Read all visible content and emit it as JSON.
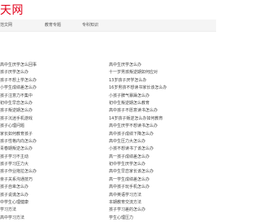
{
  "site": {
    "logo_text": "天网",
    "accent_color": "#e2001a"
  },
  "nav": {
    "items": [
      {
        "label": "范文网"
      },
      {
        "label": "教育专题"
      },
      {
        "label": "专科知识"
      }
    ]
  },
  "articles_left": [
    {
      "title": "高中生厌学怎么回事"
    },
    {
      "title": "孩子厌学怎么办"
    },
    {
      "title": "孩子不想上学怎么办"
    },
    {
      "title": "小学生成绩差怎么办"
    },
    {
      "title": "孩子注意力不集中"
    },
    {
      "title": "初中生早恋怎么办"
    },
    {
      "title": "孩子叛逆期怎么办"
    },
    {
      "title": "孩子沉迷手机游戏"
    },
    {
      "title": "孩子心理问题"
    },
    {
      "title": "家长如何教育孩子"
    },
    {
      "title": "孩子性格内向怎么办"
    },
    {
      "title": "青春期叛逆怎么办"
    },
    {
      "title": "孩子学习不主动"
    },
    {
      "title": "孩子学习压力大"
    },
    {
      "title": "孩子作业拖拉怎么办"
    },
    {
      "title": "亲子关系沟通技巧"
    },
    {
      "title": "孩子自卑怎么办"
    },
    {
      "title": "孩子说谎怎么办"
    },
    {
      "title": "中学生心理健康"
    },
    {
      "title": "学习方法"
    },
    {
      "title": "高中学习方法"
    }
  ],
  "articles_right": [
    {
      "title": "高中生厌学怎么办"
    },
    {
      "title": "十一岁男孩叛逆期如何应对"
    },
    {
      "title": "13岁孩子厌学怎么办"
    },
    {
      "title": "16岁男孩不想读书家长该怎么办"
    },
    {
      "title": "小孩子脾气暴躁怎么办"
    },
    {
      "title": "初中生叛逆期怎么教育"
    },
    {
      "title": "高中孩子不愿意读书怎么办"
    },
    {
      "title": "14岁孩子叛逆怎么办如何教育"
    },
    {
      "title": "高中生厌学不想读书怎么办"
    },
    {
      "title": "高中孩子成绩下降怎么办"
    },
    {
      "title": "高中生压力大怎么办"
    },
    {
      "title": "小孩不想读书了该怎么办"
    },
    {
      "title": "高一孩子成绩差怎么办"
    },
    {
      "title": "初中学生厌学怎么办"
    },
    {
      "title": "高中生早恋家长该怎么办"
    },
    {
      "title": "高一学生成绩差怎么办"
    },
    {
      "title": "高中孩子玩手机怎么办"
    },
    {
      "title": "高中英语学习方法"
    },
    {
      "title": "本期教育交流方法"
    },
    {
      "title": "孩子学习差的怎么办"
    },
    {
      "title": "学生心理压力"
    }
  ]
}
